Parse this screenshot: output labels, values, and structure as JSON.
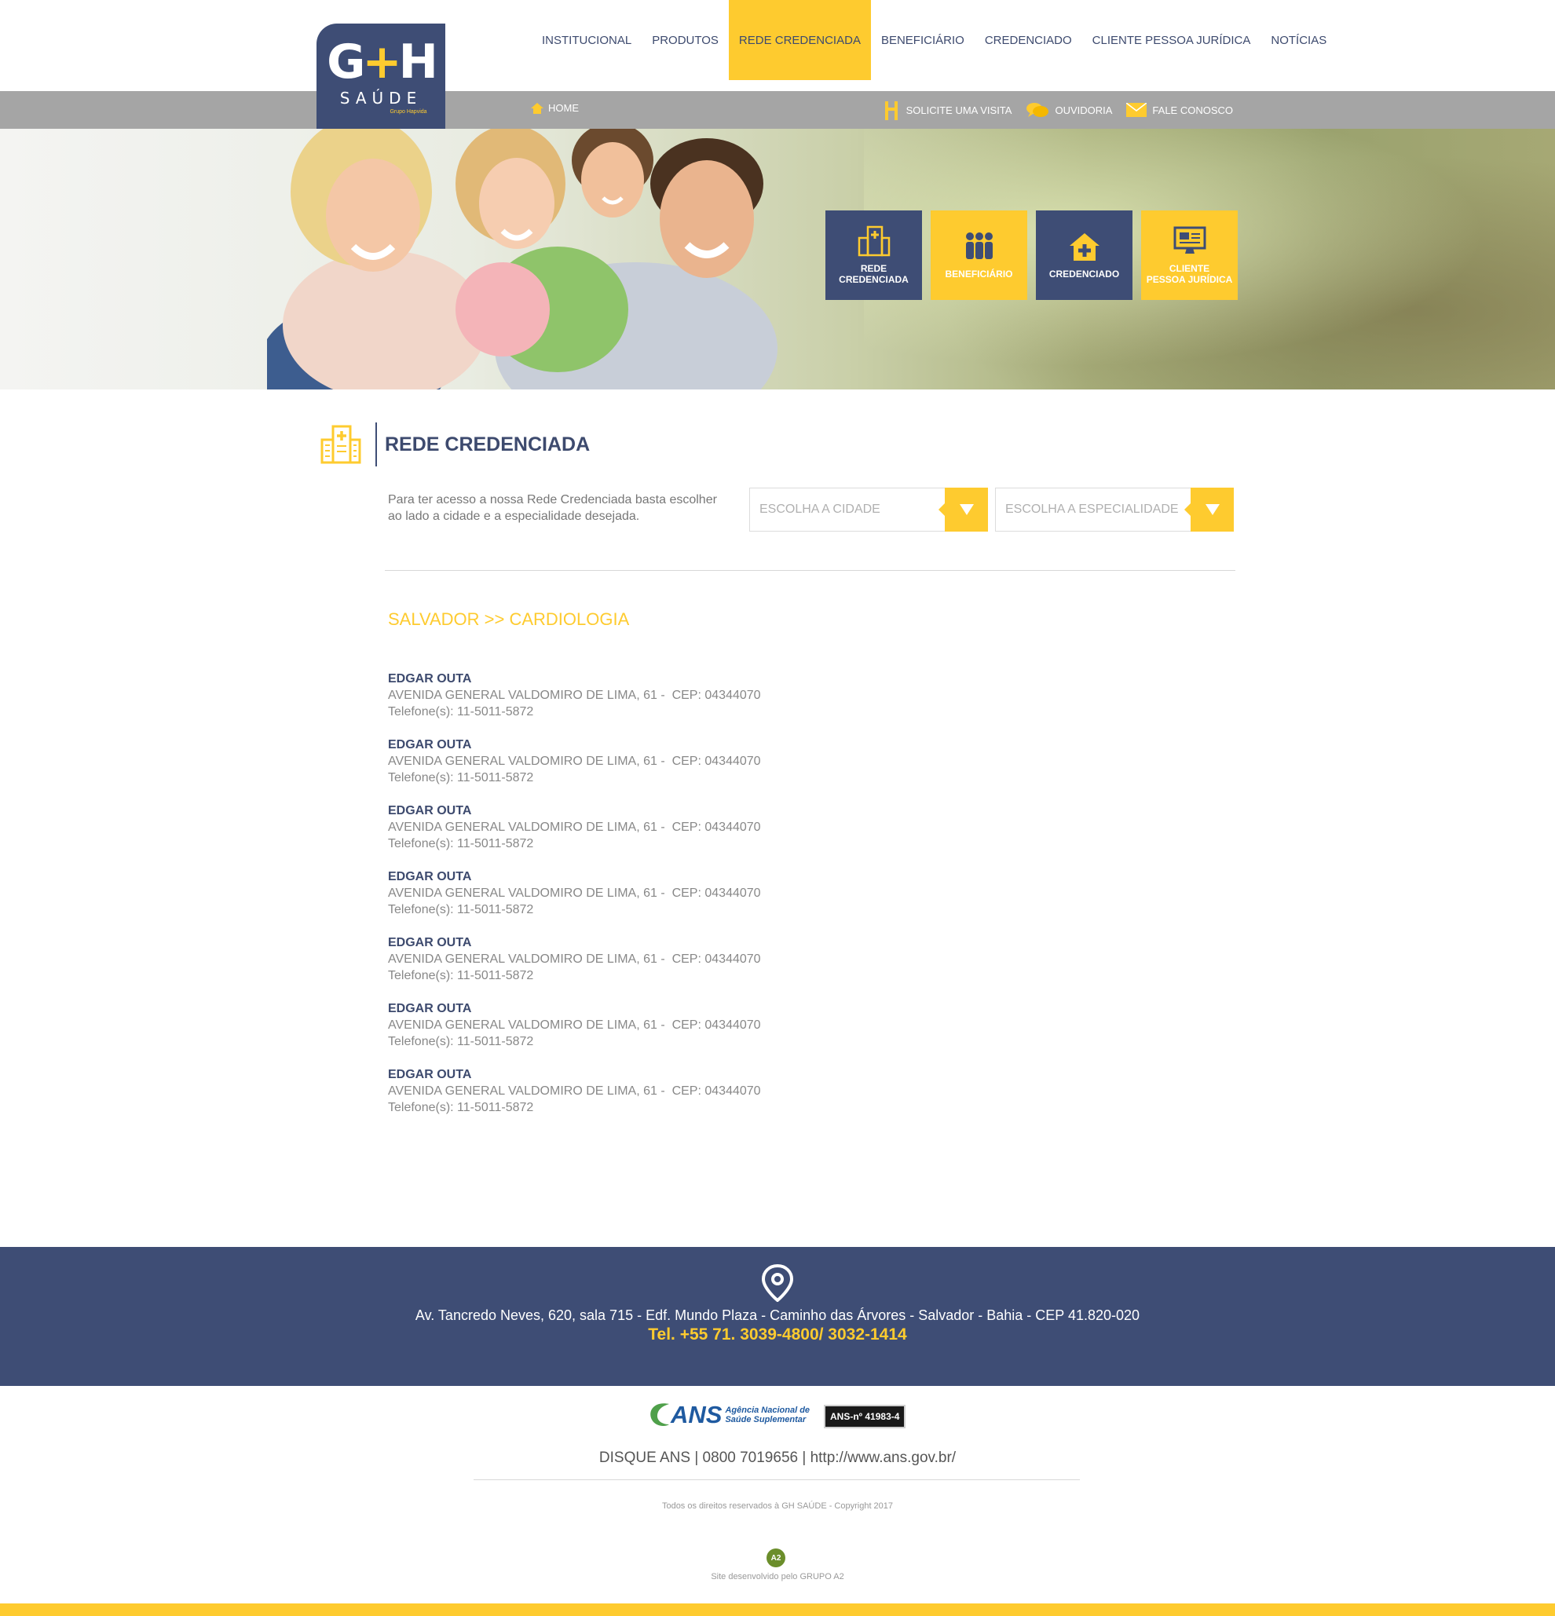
{
  "brand": {
    "logo_mark_g": "G",
    "logo_mark_plus": "+",
    "logo_mark_h": "H",
    "logo_sub": "SAÚDE",
    "logo_tag": "Grupo Hapvida",
    "accent": "#fecb2f",
    "navy": "#3e4d75"
  },
  "nav": {
    "items": [
      {
        "label": "INSTITUCIONAL"
      },
      {
        "label": "PRODUTOS"
      },
      {
        "label": "REDE CREDENCIADA",
        "active": true
      },
      {
        "label": "BENEFICIÁRIO"
      },
      {
        "label": "CREDENCIADO"
      },
      {
        "label": "CLIENTE PESSOA JURÍDICA"
      },
      {
        "label": "NOTÍCIAS"
      }
    ]
  },
  "subbar": {
    "home": "HOME",
    "links": [
      {
        "label": "SOLICITE UMA VISITA",
        "icon": "visit-icon"
      },
      {
        "label": "OUVIDORIA",
        "icon": "chat-icon"
      },
      {
        "label": "FALE CONOSCO",
        "icon": "envelope-icon"
      }
    ]
  },
  "tiles": [
    {
      "line1": "REDE",
      "line2": "CREDENCIADA",
      "icon": "hospital-icon"
    },
    {
      "line1": "BENEFICIÁRIO",
      "line2": "",
      "icon": "people-icon"
    },
    {
      "line1": "CREDENCIADO",
      "line2": "",
      "icon": "house-plus-icon"
    },
    {
      "line1": "CLIENTE",
      "line2": "PESSOA JURÍDICA",
      "icon": "monitor-icon"
    }
  ],
  "section": {
    "title": "REDE CREDENCIADA",
    "intro": "Para ter acesso a nossa Rede Credenciada basta escolher ao lado a cidade e a especialidade desejada.",
    "city_placeholder": "ESCOLHA A CIDADE",
    "specialty_placeholder": "ESCOLHA A ESPECIALIDADE",
    "crumb": "SALVADOR >> CARDIOLOGIA"
  },
  "results": [
    {
      "name": "EDGAR OUTA",
      "address": "AVENIDA GENERAL VALDOMIRO DE LIMA, 61 -  CEP: 04344070",
      "phone": "Telefone(s): 11-5011-5872"
    },
    {
      "name": "EDGAR OUTA",
      "address": "AVENIDA GENERAL VALDOMIRO DE LIMA, 61 -  CEP: 04344070",
      "phone": "Telefone(s): 11-5011-5872"
    },
    {
      "name": "EDGAR OUTA",
      "address": "AVENIDA GENERAL VALDOMIRO DE LIMA, 61 -  CEP: 04344070",
      "phone": "Telefone(s): 11-5011-5872"
    },
    {
      "name": "EDGAR OUTA",
      "address": "AVENIDA GENERAL VALDOMIRO DE LIMA, 61 -  CEP: 04344070",
      "phone": "Telefone(s): 11-5011-5872"
    },
    {
      "name": "EDGAR OUTA",
      "address": "AVENIDA GENERAL VALDOMIRO DE LIMA, 61 -  CEP: 04344070",
      "phone": "Telefone(s): 11-5011-5872"
    },
    {
      "name": "EDGAR OUTA",
      "address": "AVENIDA GENERAL VALDOMIRO DE LIMA, 61 -  CEP: 04344070",
      "phone": "Telefone(s): 11-5011-5872"
    },
    {
      "name": "EDGAR OUTA",
      "address": "AVENIDA GENERAL VALDOMIRO DE LIMA, 61 -  CEP: 04344070",
      "phone": "Telefone(s): 11-5011-5872"
    }
  ],
  "footer": {
    "address": "Av. Tancredo Neves, 620, sala 715 - Edf. Mundo Plaza - Caminho das Árvores - Salvador - Bahia - CEP 41.820-020",
    "phone": "Tel. +55 71. 3039-4800/ 3032-1414",
    "ans_mark": "ANS",
    "ans_line1": "Agência Nacional de",
    "ans_line2": "Saúde Suplementar",
    "ans_badge": "ANS-nº 41983-4",
    "disque": "DISQUE ANS | 0800 7019656 | http://www.ans.gov.br/",
    "copyright": "Todos os direitos reservados à GH SAÚDE - Copyright 2017",
    "dev_logo": "A2",
    "developer": "Site desenvolvido pelo GRUPO A2"
  }
}
